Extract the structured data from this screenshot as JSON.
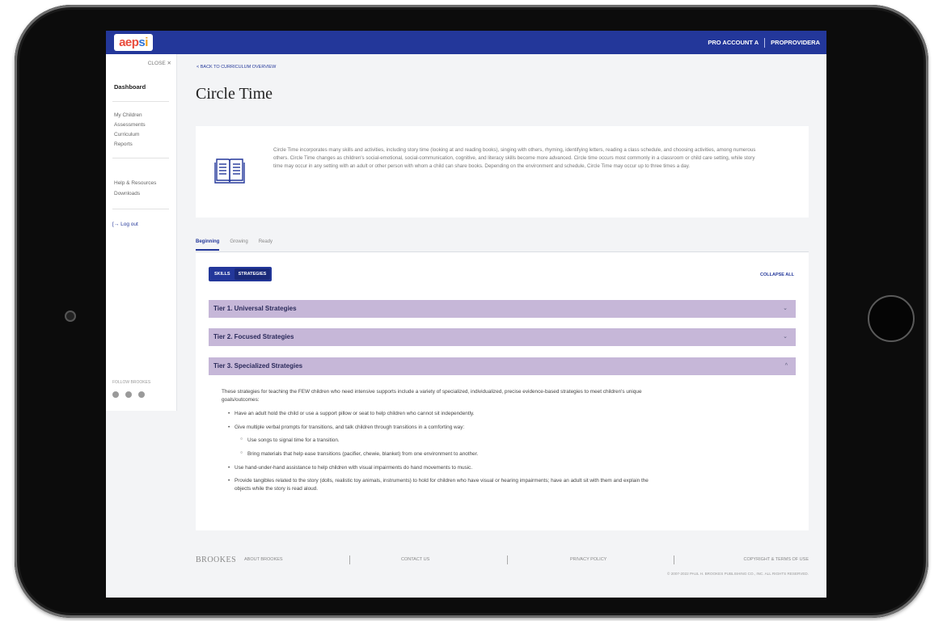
{
  "header": {
    "logo": "aepsi",
    "account_name": "PRO ACCOUNT A",
    "provider_name": "PROPROVIDERA"
  },
  "sidebar": {
    "close_label": "CLOSE ✕",
    "dashboard": "Dashboard",
    "items": [
      "My Children",
      "Assessments",
      "Curriculum",
      "Reports"
    ],
    "items2": [
      "Help & Resources",
      "Downloads"
    ],
    "logout": "Log out",
    "follow": "FOLLOW BROOKES"
  },
  "main": {
    "back_link": "< BACK TO CURRICULUM OVERVIEW",
    "title": "Circle Time",
    "description": "Circle Time incorporates many skills and activities, including story time (looking at and reading books), singing with others, rhyming, identifying letters, reading a class schedule, and choosing activities, among numerous others. Circle Time changes as children's social-emotional, social-communication, cognitive, and literacy skills become more advanced. Circle time occurs most commonly in a classroom or child care setting, while story time may occur in any setting with an adult or other person with whom a child can share books. Depending on the environment and schedule, Circle Time may occur up to three times a day.",
    "tabs": [
      "Beginning",
      "Growing",
      "Ready"
    ],
    "toggle": [
      "SKILLS",
      "STRATEGIES"
    ],
    "collapse_all": "COLLAPSE ALL",
    "tiers": [
      {
        "label": "Tier 1. Universal Strategies",
        "chev": "⌄"
      },
      {
        "label": "Tier 2. Focused Strategies",
        "chev": "⌄"
      },
      {
        "label": "Tier 3. Specialized Strategies",
        "chev": "^"
      }
    ],
    "tier3": {
      "intro": "These strategies for teaching the FEW children who need intensive supports include a variety of specialized, individualized, precise evidence-based strategies to meet children's unique goals/outcomes:",
      "b1": "Have an adult hold the child or use a support pillow or seat to help children who cannot sit independently.",
      "b2": "Give multiple verbal prompts for transitions, and talk children through transitions in a comforting way:",
      "c1": "Use songs to signal time for a transition.",
      "c2": "Bring materials that help ease transitions (pacifier, chewie, blanket) from one environment to another.",
      "b3": "Use hand-under-hand assistance to help children with visual impairments do hand movements to music.",
      "b4": "Provide tangibles related to the story (dolls, realistic toy animals, instruments) to hold for children who have visual or hearing impairments; have an adult sit with them and explain the objects while the story is read aloud."
    }
  },
  "footer": {
    "brand": "BROOKES",
    "links": [
      "ABOUT BROOKES",
      "CONTACT US",
      "PRIVACY POLICY",
      "COPYRIGHT & TERMS OF USE"
    ],
    "copyright": "© 2007-2022 PAUL H. BROOKES PUBLISHING CO., INC. ALL RIGHTS RESERVED."
  },
  "colors": {
    "brand_blue": "#23379a",
    "tier_purple": "#c6b7d8"
  }
}
